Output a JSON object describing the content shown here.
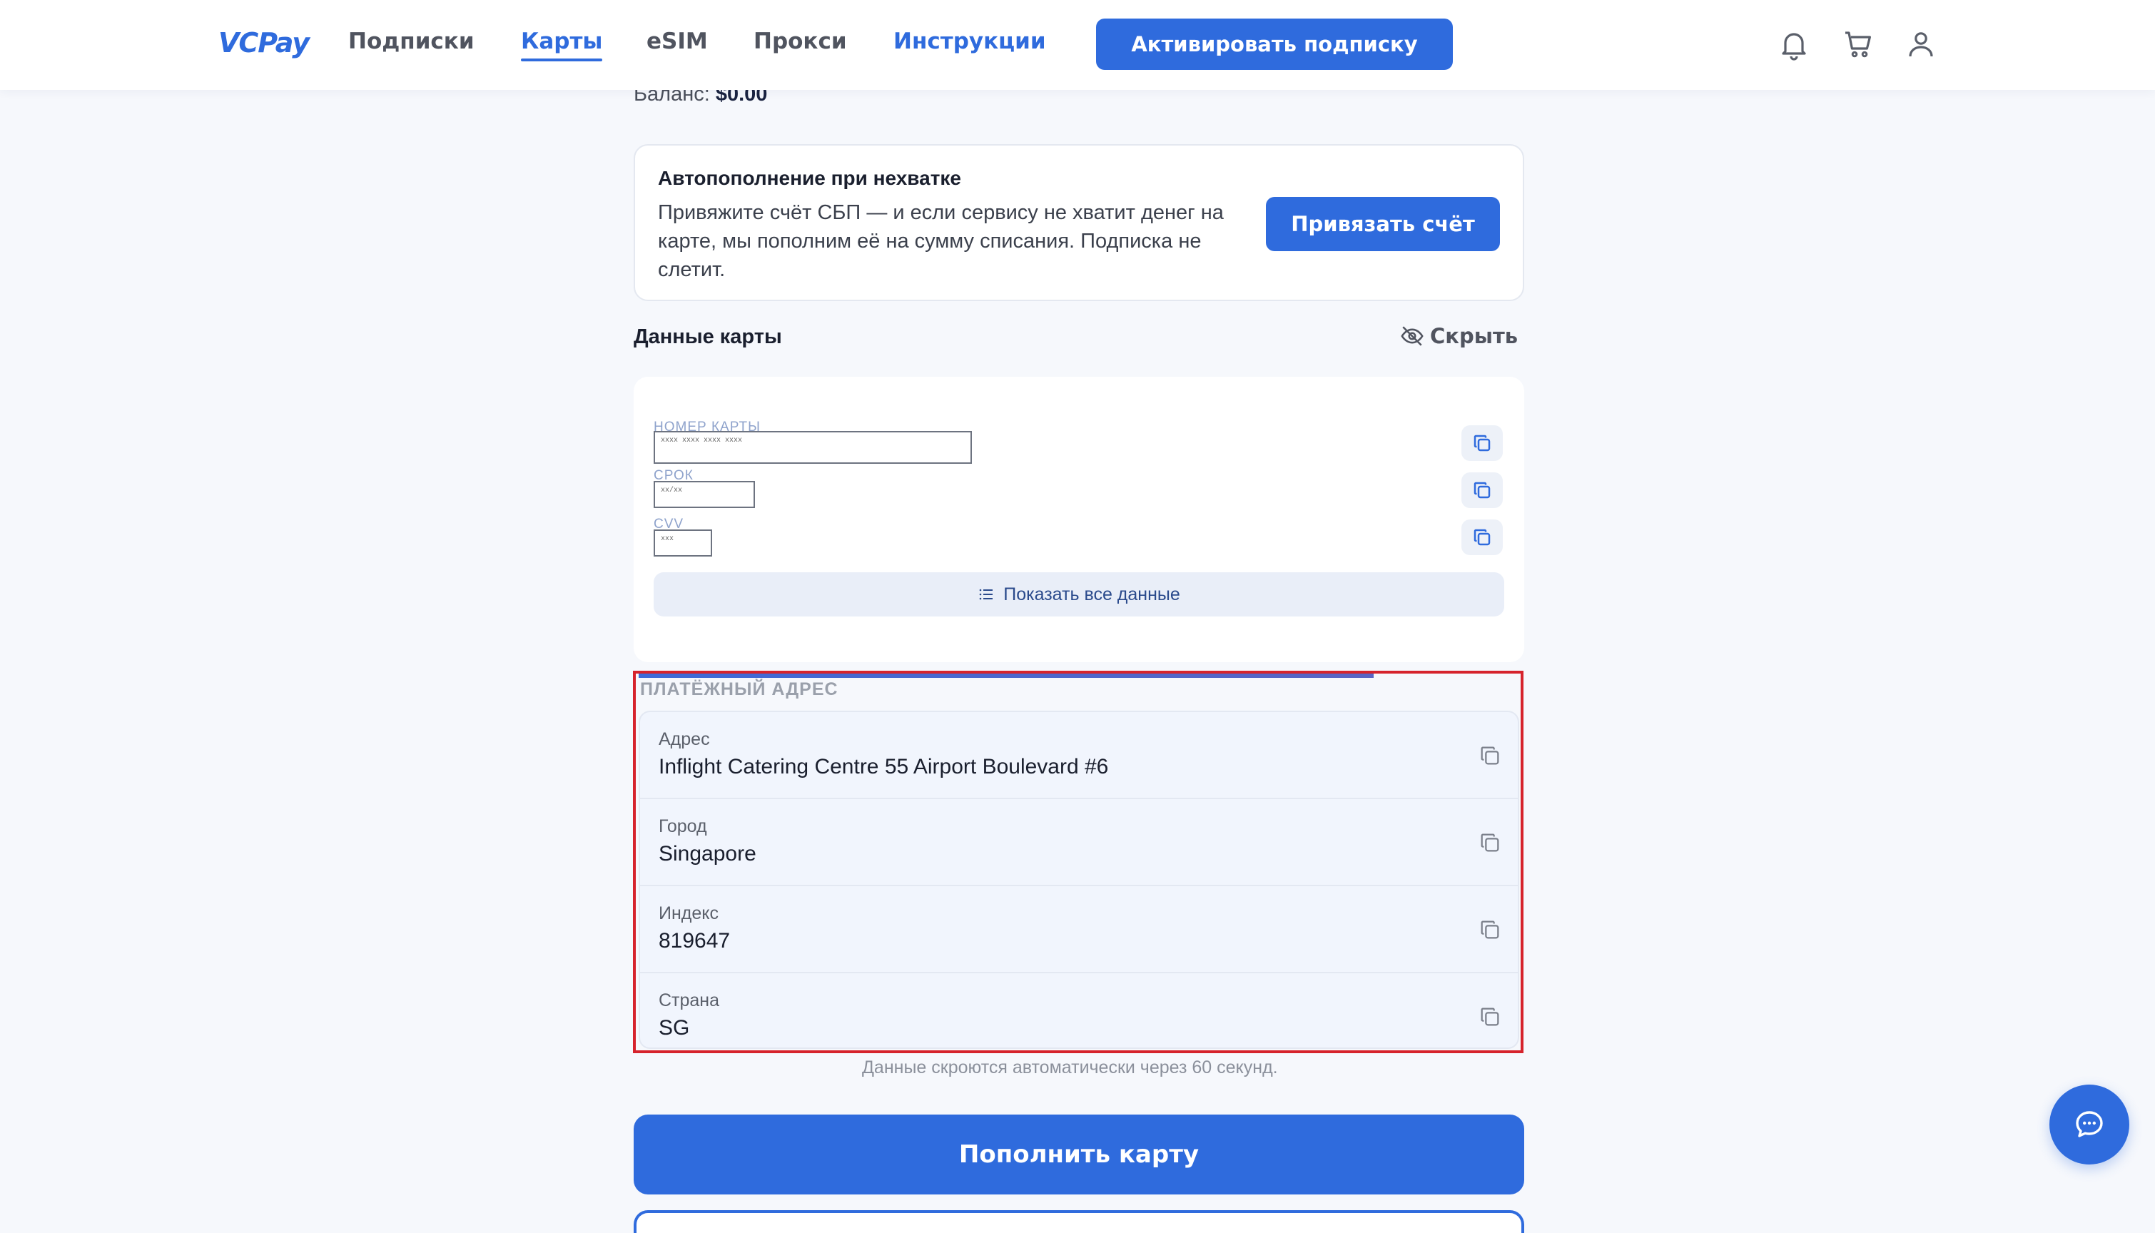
{
  "header": {
    "logo": "VCPay",
    "nav": [
      "Подписки",
      "Карты",
      "eSIM",
      "Прокси",
      "Инструкции"
    ],
    "activate_label": "Активировать подписку",
    "icons": [
      "bell-icon",
      "cart-icon",
      "user-icon"
    ]
  },
  "balance": {
    "label": "Баланс:",
    "value": "$0.00"
  },
  "auto_topup": {
    "title": "Автопополнение при нехватке",
    "description": "Привяжите счёт СБП — и если сервису не хватит денег на карте, мы пополним её на сумму списания. Подписка не слетит.",
    "button": "Привязать счёт"
  },
  "card_data": {
    "title": "Данные карты",
    "hide_label": "Скрыть",
    "fields": [
      {
        "label": "НОМЕР КАРТЫ",
        "value": "xxxx xxxx xxxx xxxx"
      },
      {
        "label": "СРОК",
        "value": "xx/xx"
      },
      {
        "label": "CVV",
        "value": "xxx"
      }
    ],
    "show_all": "Показать все данные"
  },
  "billing": {
    "title": "ПЛАТЁЖНЫЙ АДРЕС",
    "rows": [
      {
        "label": "Адрес",
        "value": "Inflight Catering Centre 55 Airport Boulevard #6"
      },
      {
        "label": "Город",
        "value": "Singapore"
      },
      {
        "label": "Индекс",
        "value": "819647"
      },
      {
        "label": "Страна",
        "value": "SG"
      }
    ]
  },
  "auto_hide_note": "Данные скроются автоматически через 60 секунд.",
  "topup_button": "Пополнить карту",
  "colors": {
    "accent": "#2f6bdd",
    "highlight": "#d6232c"
  }
}
